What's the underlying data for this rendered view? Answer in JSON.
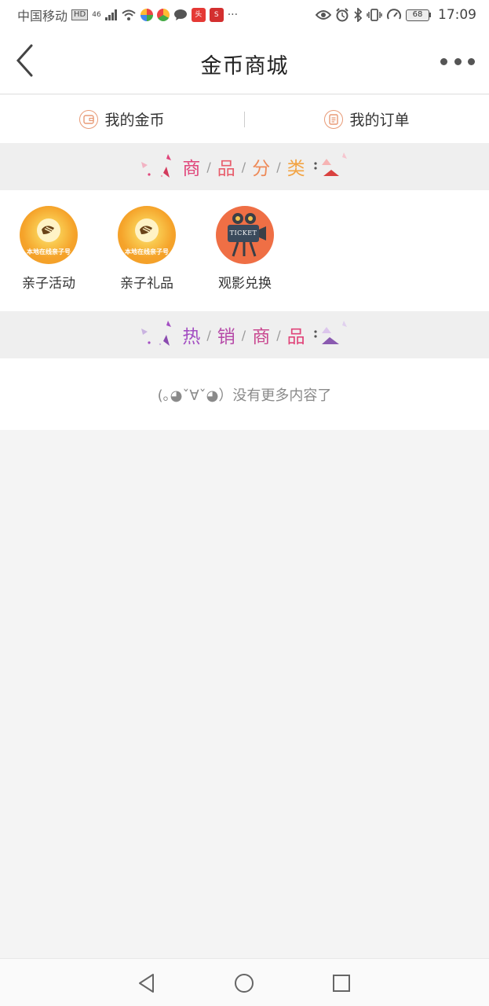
{
  "status_bar": {
    "carrier": "中国移动",
    "hd_badge": "HD",
    "network": "46",
    "battery_level": "68",
    "time": "17:09",
    "more_glyph": "···"
  },
  "nav": {
    "title": "金币商城",
    "back_icon": "chevron-left-icon",
    "more_icon": "more-horizontal-icon"
  },
  "tabs": [
    {
      "label": "我的金币",
      "icon": "wallet-icon"
    },
    {
      "label": "我的订单",
      "icon": "order-list-icon"
    }
  ],
  "categories_section": {
    "title_chars": [
      "商",
      "品",
      "分",
      "类"
    ],
    "separator": "/"
  },
  "categories": [
    {
      "label": "亲子活动",
      "icon": "parenting-logo-icon",
      "logo_text": "本地在线亲子号"
    },
    {
      "label": "亲子礼品",
      "icon": "parenting-logo-icon",
      "logo_text": "本地在线亲子号"
    },
    {
      "label": "观影兑换",
      "icon": "movie-camera-icon",
      "logo_text": "TICKET"
    }
  ],
  "hot_section": {
    "title_chars": [
      "热",
      "销",
      "商",
      "品"
    ],
    "separator": "/"
  },
  "empty_hint": "(｡◕ˇ∀ˇ◕）没有更多内容了",
  "colors": {
    "accent_orange": "#e8956f",
    "section1_gradient_start": "#e0457a",
    "section1_gradient_end": "#f2a444",
    "section2_gradient_start": "#a34ec2",
    "section2_gradient_end": "#e0457a",
    "logo_orange": "#f5a32a",
    "ticket_bg": "#ef6f45"
  }
}
